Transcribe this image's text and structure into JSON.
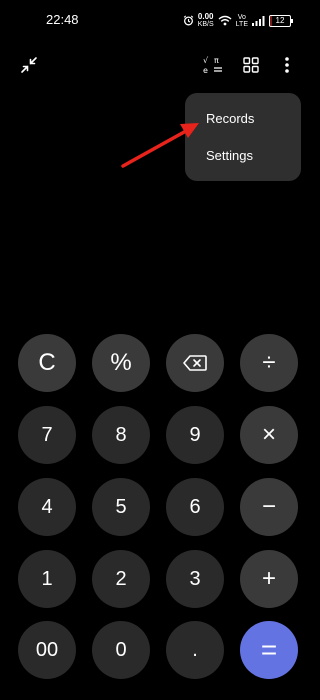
{
  "status_bar": {
    "time": "22:48",
    "net_speed_value": "0.00",
    "net_speed_unit": "KB/S",
    "volte_top": "Vo",
    "volte_bottom": "LTE",
    "battery": "12",
    "battery_level": 0.12
  },
  "toolbar": {
    "minimize_icon": "collapse-arrows-icon",
    "scientific_icon": "scientific-functions-icon",
    "converter_icon": "grid-icon",
    "more_icon": "more-vert-icon"
  },
  "menu": {
    "items": [
      {
        "label": "Records"
      },
      {
        "label": "Settings"
      }
    ]
  },
  "annotation": {
    "color": "#e8231c"
  },
  "keypad": {
    "rows": [
      [
        "C",
        "%",
        "backspace",
        "÷"
      ],
      [
        "7",
        "8",
        "9",
        "×"
      ],
      [
        "4",
        "5",
        "6",
        "−"
      ],
      [
        "1",
        "2",
        "3",
        "+"
      ],
      [
        "00",
        "0",
        ".",
        "="
      ]
    ],
    "clear": "C",
    "percent": "%",
    "divide": "÷",
    "seven": "7",
    "eight": "8",
    "nine": "9",
    "multiply": "×",
    "four": "4",
    "five": "5",
    "six": "6",
    "minus": "−",
    "one": "1",
    "two": "2",
    "three": "3",
    "plus": "+",
    "double_zero": "00",
    "zero": "0",
    "decimal": ".",
    "equals": "="
  },
  "colors": {
    "background": "#000000",
    "key": "#2a2a2a",
    "operator_key": "#3a3a3a",
    "equals_key": "#6473e2",
    "menu": "#2f2f2f"
  }
}
